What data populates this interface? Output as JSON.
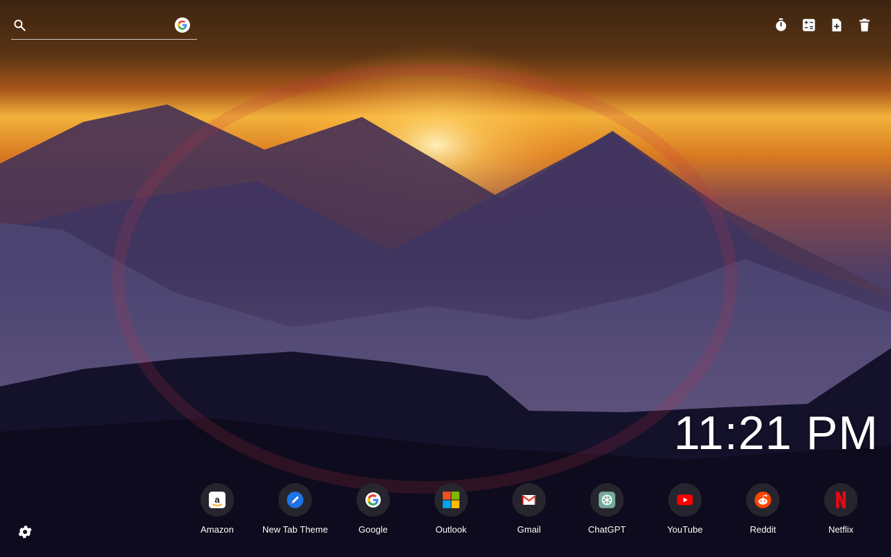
{
  "search": {
    "placeholder": "",
    "value": ""
  },
  "toolbar": {
    "items": [
      {
        "icon": "stopwatch-icon"
      },
      {
        "icon": "calculator-icon"
      },
      {
        "icon": "add-note-icon"
      },
      {
        "icon": "trash-icon"
      }
    ]
  },
  "clock": {
    "time": "11:21 PM"
  },
  "shortcuts": [
    {
      "label": "Amazon",
      "icon": "amazon-icon"
    },
    {
      "label": "New Tab Theme",
      "icon": "new-tab-theme-icon"
    },
    {
      "label": "Google",
      "icon": "google-icon"
    },
    {
      "label": "Outlook",
      "icon": "outlook-icon"
    },
    {
      "label": "Gmail",
      "icon": "gmail-icon"
    },
    {
      "label": "ChatGPT",
      "icon": "chatgpt-icon"
    },
    {
      "label": "YouTube",
      "icon": "youtube-icon"
    },
    {
      "label": "Reddit",
      "icon": "reddit-icon"
    },
    {
      "label": "Netflix",
      "icon": "netflix-icon"
    }
  ],
  "colors": {
    "sky_top": "#4a2a10",
    "sunset_glow": "#f5a623",
    "mountain_far": "#5a4a6a",
    "mountain_near": "#120f24"
  }
}
